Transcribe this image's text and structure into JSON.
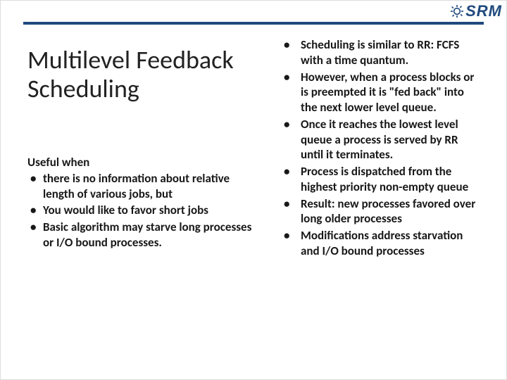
{
  "brand": {
    "name": "SRM"
  },
  "left": {
    "title": "Multilevel Feedback Scheduling",
    "lead": "Useful when",
    "items": [
      "there is no information about relative length of various jobs, but",
      "You would like to favor short jobs",
      "Basic algorithm may starve long processes or I/O bound processes."
    ]
  },
  "right": {
    "items": [
      "Scheduling is similar to RR: FCFS with a time quantum.",
      "However, when a process blocks or is preempted it is \"fed back\" into the next lower level queue.",
      "Once it reaches the lowest level queue a process is served by RR until it terminates.",
      "Process is dispatched from the highest priority non-empty queue",
      "Result: new processes favored over long older processes",
      "Modifications address starvation and I/O bound processes"
    ]
  }
}
